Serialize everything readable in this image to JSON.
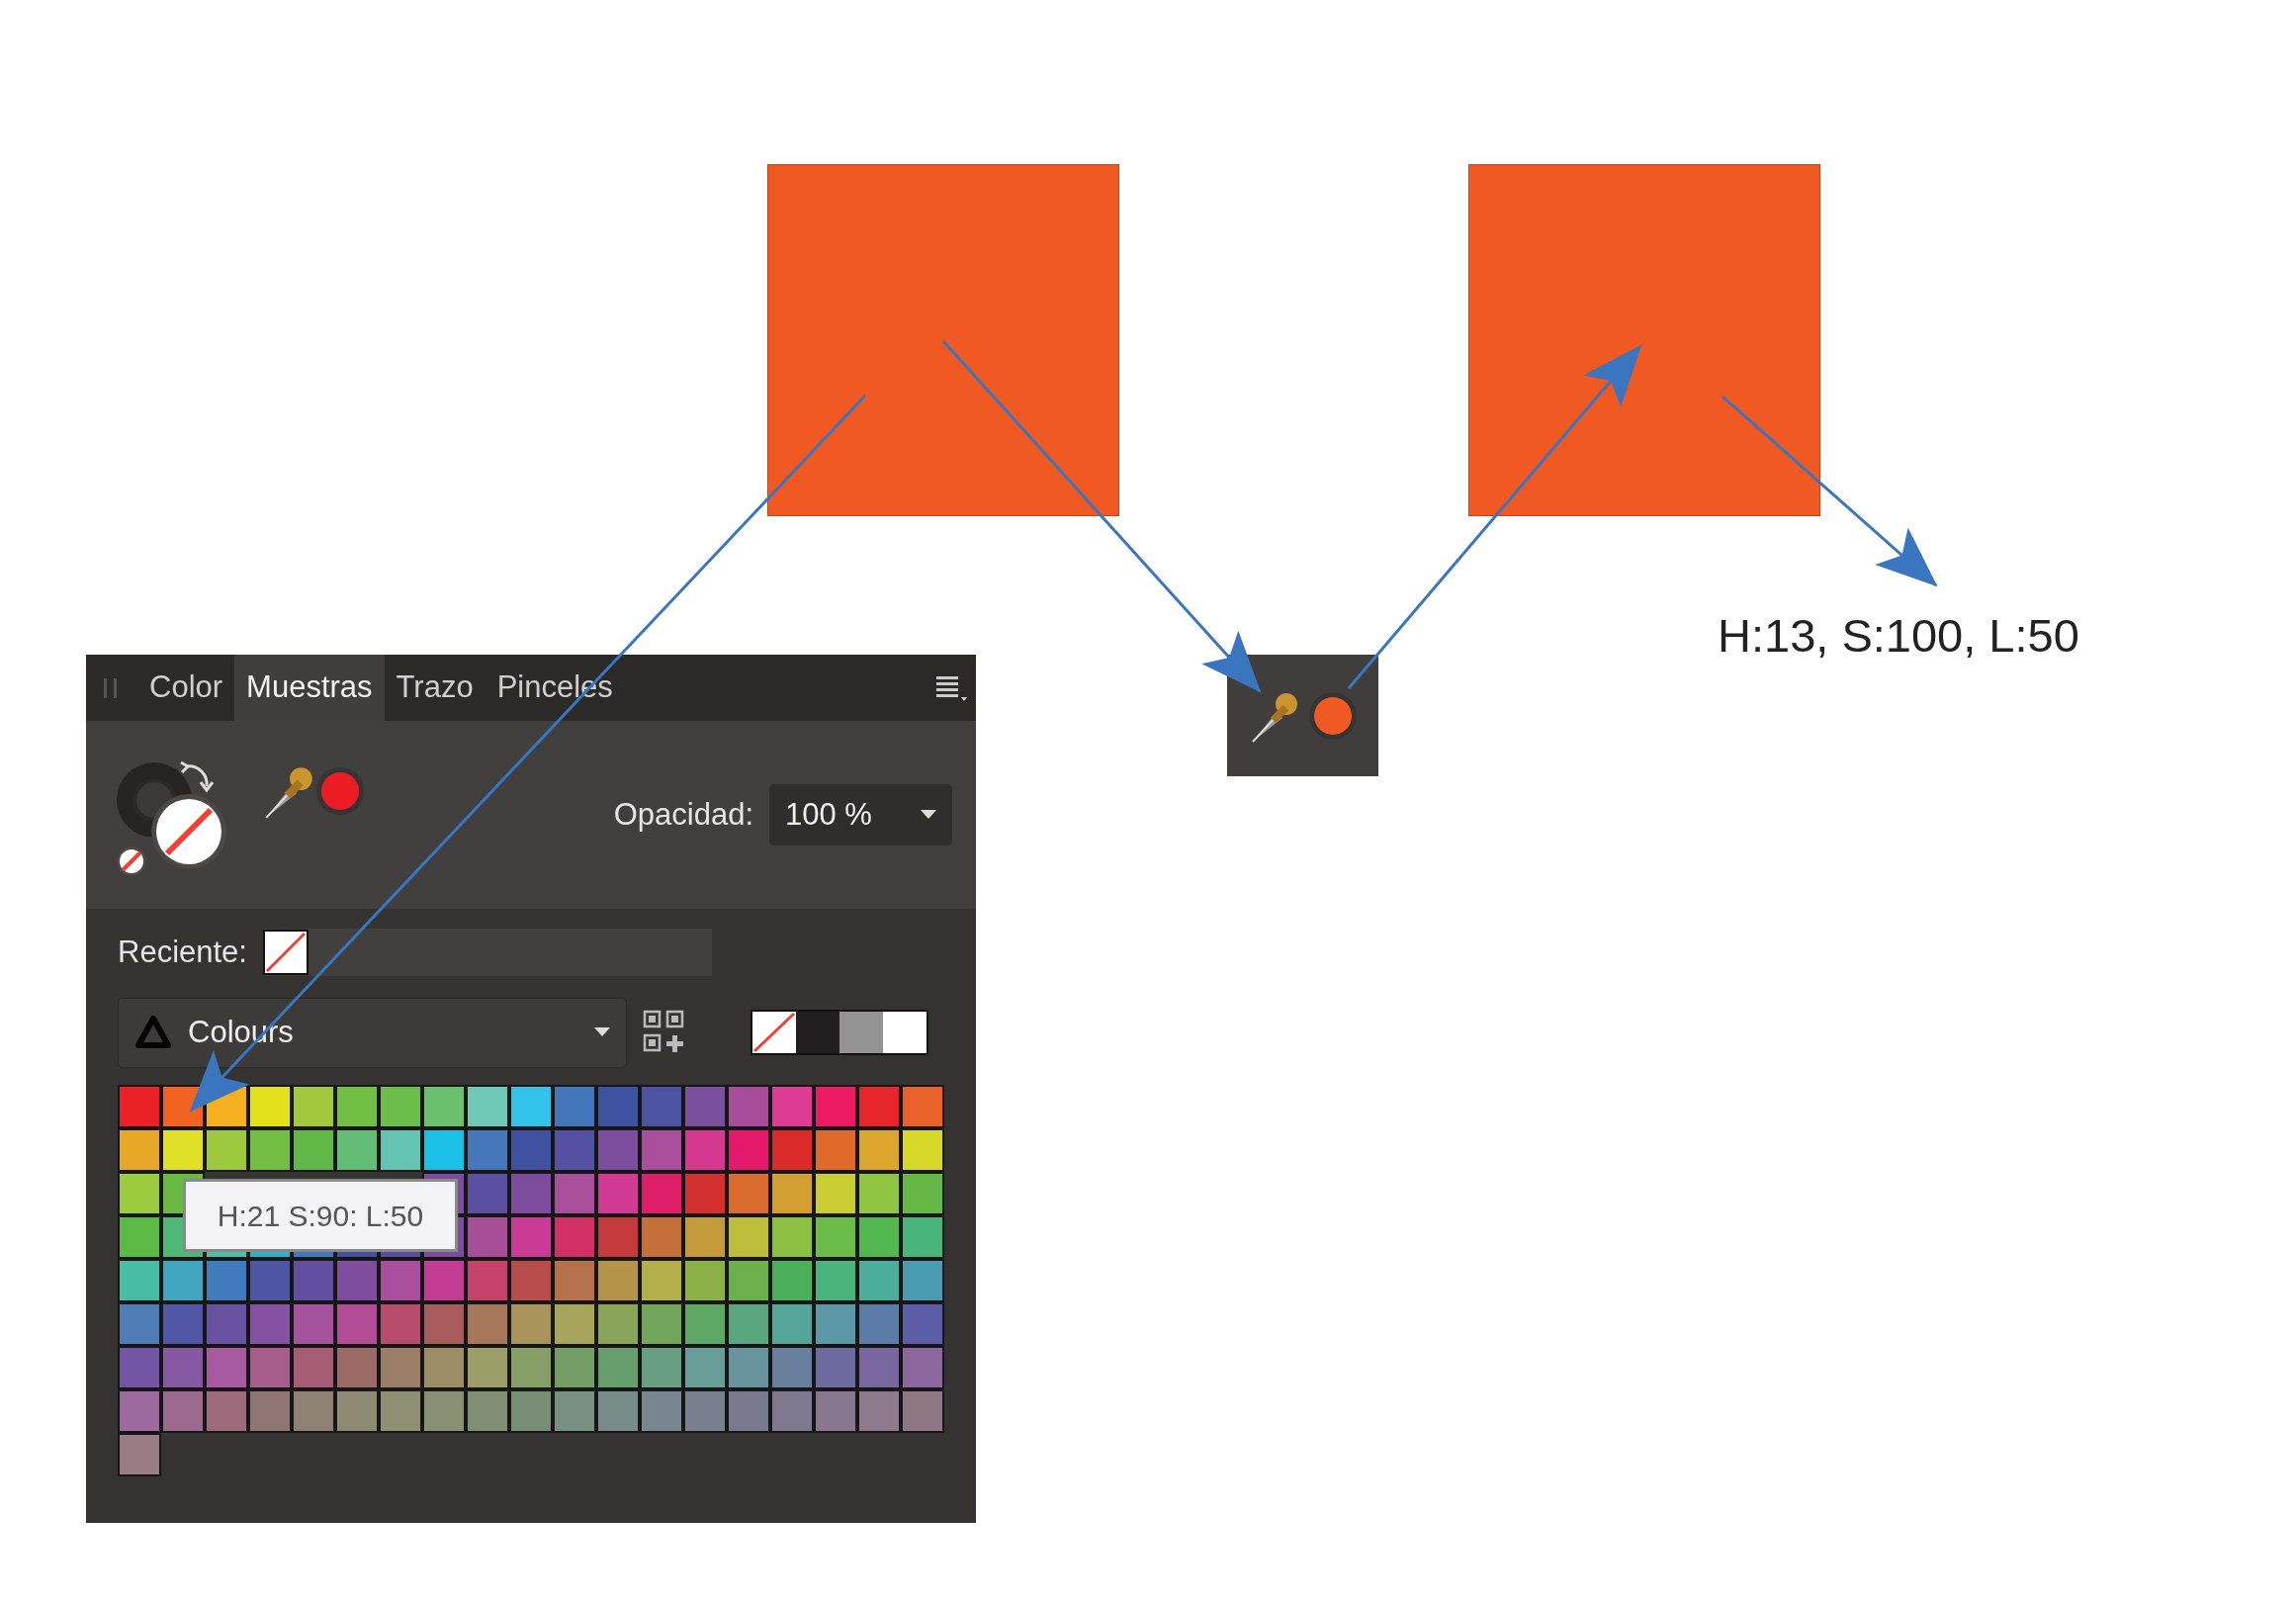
{
  "panel": {
    "tabs": [
      {
        "label": "Color",
        "selected": false
      },
      {
        "label": "Muestras",
        "selected": true
      },
      {
        "label": "Trazo",
        "selected": false
      },
      {
        "label": "Pinceles",
        "selected": false
      }
    ],
    "opacity": {
      "label": "Opacidad:",
      "value": "100 %"
    },
    "recent": {
      "label": "Reciente:"
    },
    "palette": {
      "name": "Colours"
    },
    "swatch_rows": [
      {
        "swatches": [
          {
            "color": "#ec2027"
          },
          {
            "color": "#f26322"
          },
          {
            "color": "#f5b01f"
          },
          {
            "color": "#e2e11c"
          },
          {
            "color": "#a2c83d"
          },
          {
            "color": "#72bf44"
          },
          {
            "color": "#6dbd4a"
          },
          {
            "color": "#6bc06e"
          },
          {
            "color": "#6dc8b6"
          },
          {
            "color": "#33c3ea"
          },
          {
            "color": "#4275b9"
          },
          {
            "color": "#3d53a1"
          },
          {
            "color": "#4e52a3"
          },
          {
            "color": "#7a4f9e"
          },
          {
            "color": "#a84d9c"
          },
          {
            "color": "#de3c92"
          },
          {
            "color": "#ec1b64"
          },
          {
            "color": "#e6262a"
          },
          {
            "color": "#e8622a"
          }
        ]
      },
      {
        "swatches": [
          {
            "color": "#e8a827"
          },
          {
            "color": "#dfe027"
          },
          {
            "color": "#9cc93e"
          },
          {
            "color": "#72bf44"
          },
          {
            "color": "#60b847"
          },
          {
            "color": "#63bd77"
          },
          {
            "color": "#64c4b4"
          },
          {
            "color": "#1bc0e6"
          },
          {
            "color": "#4577ba"
          },
          {
            "color": "#3f51a0"
          },
          {
            "color": "#5451a2"
          },
          {
            "color": "#7b4d9d"
          },
          {
            "color": "#a84e9d"
          },
          {
            "color": "#d5398f"
          },
          {
            "color": "#e4196a"
          },
          {
            "color": "#db2a2a"
          },
          {
            "color": "#e06a29"
          },
          {
            "color": "#dca52b"
          },
          {
            "color": "#d6d928"
          }
        ]
      },
      {
        "swatches": [
          {
            "color": "#9ccb3d"
          },
          {
            "color": "#6ab945"
          }
        ],
        "swatches_right": [
          {
            "color": "#7c4d9d"
          },
          {
            "color": "#5a4fa0"
          },
          {
            "color": "#7d4c9c"
          },
          {
            "color": "#a84e9b"
          },
          {
            "color": "#d13a94"
          },
          {
            "color": "#de1e69"
          },
          {
            "color": "#d2312f"
          },
          {
            "color": "#d96c2e"
          },
          {
            "color": "#d39f30"
          },
          {
            "color": "#c9cc32"
          },
          {
            "color": "#8ec641"
          },
          {
            "color": "#66b846"
          }
        ]
      },
      {
        "swatches": [
          {
            "color": "#5bb946"
          },
          {
            "color": "#4fb878"
          },
          {
            "color": "#4cc0a8"
          },
          {
            "color": "#31b0cc"
          },
          {
            "color": "#3f7bbe"
          },
          {
            "color": "#4351a0"
          },
          {
            "color": "#5a4d9f"
          },
          {
            "color": "#7f4b9c"
          },
          {
            "color": "#a64e98"
          },
          {
            "color": "#c93b94"
          },
          {
            "color": "#d32f67"
          },
          {
            "color": "#c53b3b"
          },
          {
            "color": "#c46e3a"
          },
          {
            "color": "#c49b3a"
          },
          {
            "color": "#bcbd3a"
          },
          {
            "color": "#8dbf42"
          },
          {
            "color": "#6abb48"
          },
          {
            "color": "#52b74f"
          },
          {
            "color": "#48b57a"
          }
        ]
      },
      {
        "swatches": [
          {
            "color": "#47bea4"
          },
          {
            "color": "#41a7c0"
          },
          {
            "color": "#407bbd"
          },
          {
            "color": "#4d56a2"
          },
          {
            "color": "#624fa0"
          },
          {
            "color": "#7e4d9d"
          },
          {
            "color": "#a74f9c"
          },
          {
            "color": "#c13c92"
          },
          {
            "color": "#c6426a"
          },
          {
            "color": "#b64c4c"
          },
          {
            "color": "#b5714b"
          },
          {
            "color": "#b5934b"
          },
          {
            "color": "#b3b04b"
          },
          {
            "color": "#8ab046"
          },
          {
            "color": "#6bb04a"
          },
          {
            "color": "#4bb05a"
          },
          {
            "color": "#4ab47c"
          },
          {
            "color": "#4aae9a"
          },
          {
            "color": "#4b9cb0"
          }
        ]
      },
      {
        "swatches": [
          {
            "color": "#4d7db4"
          },
          {
            "color": "#5156a6"
          },
          {
            "color": "#6a52a2"
          },
          {
            "color": "#8452a0"
          },
          {
            "color": "#a5529e"
          },
          {
            "color": "#b24c95"
          },
          {
            "color": "#b74c6d"
          },
          {
            "color": "#a85b5b"
          },
          {
            "color": "#a7775b"
          },
          {
            "color": "#a8945b"
          },
          {
            "color": "#a6a55b"
          },
          {
            "color": "#89a55a"
          },
          {
            "color": "#72a65a"
          },
          {
            "color": "#5da865"
          },
          {
            "color": "#5aa67f"
          },
          {
            "color": "#56a599"
          },
          {
            "color": "#5b99a7"
          },
          {
            "color": "#5b7ca7"
          },
          {
            "color": "#5b5da7"
          }
        ]
      },
      {
        "swatches": [
          {
            "color": "#7356a3"
          },
          {
            "color": "#8559a2"
          },
          {
            "color": "#a85ba0"
          },
          {
            "color": "#a75d8c"
          },
          {
            "color": "#a65d73"
          },
          {
            "color": "#9b6a66"
          },
          {
            "color": "#9b7e66"
          },
          {
            "color": "#9b8e66"
          },
          {
            "color": "#9b9e66"
          },
          {
            "color": "#879e66"
          },
          {
            "color": "#739e66"
          },
          {
            "color": "#679e6e"
          },
          {
            "color": "#689e84"
          },
          {
            "color": "#689e97"
          },
          {
            "color": "#68949e"
          },
          {
            "color": "#687f9e"
          },
          {
            "color": "#6c6a9e"
          },
          {
            "color": "#77679e"
          },
          {
            "color": "#8c679e"
          }
        ]
      },
      {
        "swatches": [
          {
            "color": "#9c6a9e"
          },
          {
            "color": "#9c6a8e"
          },
          {
            "color": "#9c6a7a"
          },
          {
            "color": "#8f7673"
          },
          {
            "color": "#8f8173"
          },
          {
            "color": "#8f8a73"
          },
          {
            "color": "#8f8f73"
          },
          {
            "color": "#888f73"
          },
          {
            "color": "#808f73"
          },
          {
            "color": "#788f76"
          },
          {
            "color": "#788f82"
          },
          {
            "color": "#788d8a"
          },
          {
            "color": "#78878f"
          },
          {
            "color": "#787f8f"
          },
          {
            "color": "#78788f"
          },
          {
            "color": "#7f788f"
          },
          {
            "color": "#88788f"
          },
          {
            "color": "#8e7a8d"
          },
          {
            "color": "#8e7883"
          }
        ]
      },
      {
        "swatches": [
          {
            "color": "#9a7c85"
          }
        ]
      }
    ],
    "tooltip": "H:21 S:90: L:50"
  },
  "annotation": "H:13, S:100, L:50"
}
